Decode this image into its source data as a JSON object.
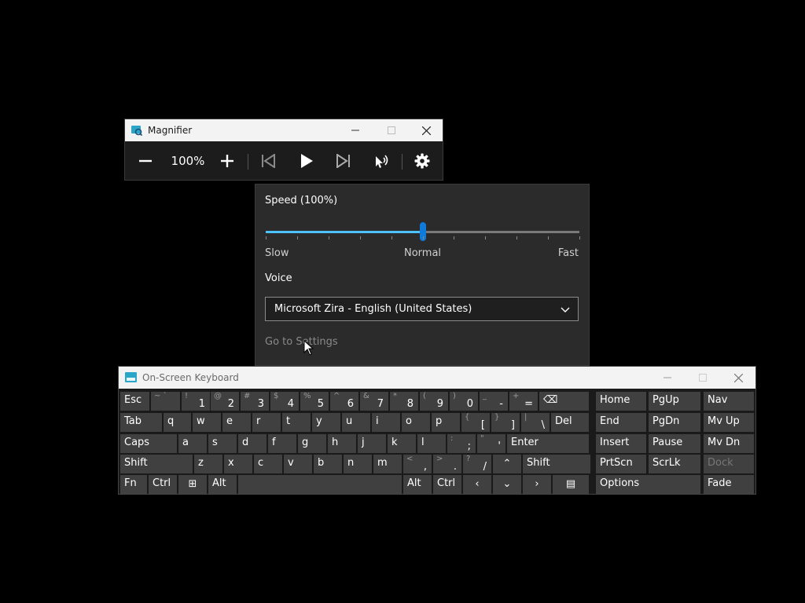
{
  "magnifier": {
    "title": "Magnifier",
    "zoom": "100%",
    "icons": {
      "zoom_out": "minus-icon",
      "zoom_in": "plus-icon",
      "previous": "skip-previous-icon",
      "play": "play-icon",
      "next": "skip-next-icon",
      "read_from_here": "read-from-here-icon",
      "settings": "gear-icon"
    }
  },
  "read_aloud": {
    "speed_label": "Speed (100%)",
    "speed_value_fraction": 0.5,
    "slow": "Slow",
    "normal": "Normal",
    "fast": "Fast",
    "voice_label": "Voice",
    "voice_value": "Microsoft Zira - English (United States)",
    "go_to_settings": "Go to Settings"
  },
  "osk": {
    "title": "On-Screen Keyboard",
    "rows": [
      [
        {
          "lbl": "Esc"
        },
        {
          "sub": "~ `",
          "main": ""
        },
        {
          "sub": "!",
          "main": "1"
        },
        {
          "sub": "@",
          "main": "2"
        },
        {
          "sub": "#",
          "main": "3"
        },
        {
          "sub": "$",
          "main": "4"
        },
        {
          "sub": "%",
          "main": "5"
        },
        {
          "sub": "^",
          "main": "6"
        },
        {
          "sub": "&",
          "main": "7"
        },
        {
          "sub": "*",
          "main": "8"
        },
        {
          "sub": "(",
          "main": "9"
        },
        {
          "sub": ")",
          "main": "0"
        },
        {
          "sub": "_",
          "main": "-"
        },
        {
          "sub": "+",
          "main": "="
        },
        {
          "lbl": "⌫"
        }
      ],
      [
        {
          "lbl": "Tab"
        },
        {
          "lbl": "q"
        },
        {
          "lbl": "w"
        },
        {
          "lbl": "e"
        },
        {
          "lbl": "r"
        },
        {
          "lbl": "t"
        },
        {
          "lbl": "y"
        },
        {
          "lbl": "u"
        },
        {
          "lbl": "i"
        },
        {
          "lbl": "o"
        },
        {
          "lbl": "p"
        },
        {
          "sub": "{",
          "main": "["
        },
        {
          "sub": "}",
          "main": "]"
        },
        {
          "sub": "|",
          "main": "\\"
        },
        {
          "lbl": "Del"
        }
      ],
      [
        {
          "lbl": "Caps"
        },
        {
          "lbl": "a"
        },
        {
          "lbl": "s"
        },
        {
          "lbl": "d"
        },
        {
          "lbl": "f"
        },
        {
          "lbl": "g"
        },
        {
          "lbl": "h"
        },
        {
          "lbl": "j"
        },
        {
          "lbl": "k"
        },
        {
          "lbl": "l"
        },
        {
          "sub": ":",
          "main": ";"
        },
        {
          "sub": "\"",
          "main": "'"
        },
        {
          "lbl": "Enter"
        }
      ],
      [
        {
          "lbl": "Shift"
        },
        {
          "lbl": "z"
        },
        {
          "lbl": "x"
        },
        {
          "lbl": "c"
        },
        {
          "lbl": "v"
        },
        {
          "lbl": "b"
        },
        {
          "lbl": "n"
        },
        {
          "lbl": "m"
        },
        {
          "sub": "<",
          "main": ","
        },
        {
          "sub": ">",
          "main": "."
        },
        {
          "sub": "?",
          "main": "/"
        },
        {
          "lbl": "⌃"
        },
        {
          "lbl": "Shift"
        }
      ],
      [
        {
          "lbl": "Fn"
        },
        {
          "lbl": "Ctrl"
        },
        {
          "lbl": "⊞"
        },
        {
          "lbl": "Alt"
        },
        {
          "lbl": ""
        },
        {
          "lbl": "Alt"
        },
        {
          "lbl": "Ctrl"
        },
        {
          "lbl": "‹"
        },
        {
          "lbl": "⌄"
        },
        {
          "lbl": "›"
        },
        {
          "lbl": "▤"
        }
      ]
    ],
    "nav_keys": [
      [
        "Home",
        "PgUp",
        "Nav"
      ],
      [
        "End",
        "PgDn",
        "Mv Up"
      ],
      [
        "Insert",
        "Pause",
        "Mv Dn"
      ],
      [
        "PrtScn",
        "ScrLk",
        "Dock"
      ],
      [
        "Options",
        "",
        "Fade"
      ]
    ]
  }
}
